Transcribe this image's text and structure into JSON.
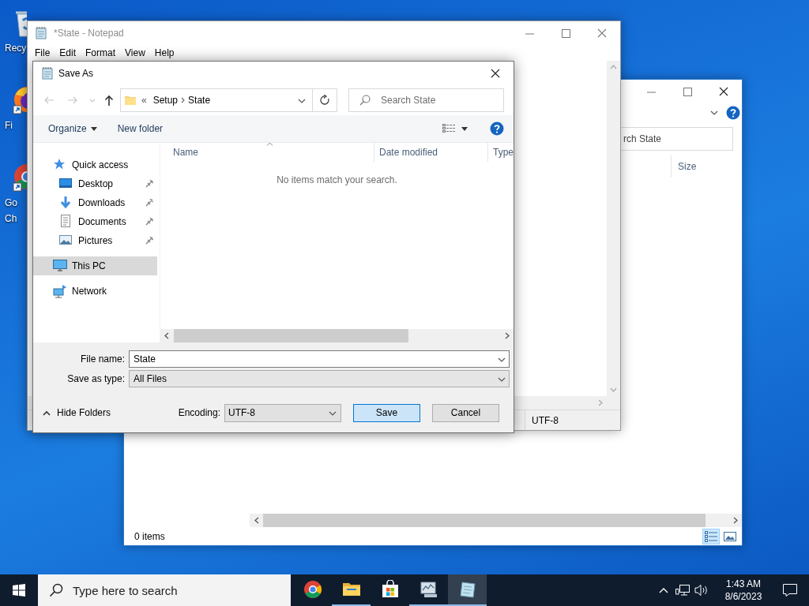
{
  "desktop_icons": [
    {
      "kind": "bin",
      "label_lines": [
        "Recy"
      ]
    },
    {
      "kind": "firefox",
      "label_lines": [
        "Fi"
      ]
    },
    {
      "kind": "chrome",
      "label_lines": [
        "Go",
        "Ch"
      ]
    }
  ],
  "explorer": {
    "search": {
      "placeholder": "rch State"
    },
    "columns": [
      "Size"
    ],
    "status": "0 items",
    "views": [
      {
        "kind": "details",
        "selected": true
      },
      {
        "kind": "tiles",
        "selected": false
      }
    ]
  },
  "notepad": {
    "title": "*State - Notepad",
    "active": false,
    "menu": [
      "File",
      "Edit",
      "Format",
      "View",
      "Help"
    ],
    "status_segments": [
      "UTF-8"
    ]
  },
  "dialog": {
    "title": "Save As",
    "nav_buttons": [
      {
        "kind": "back",
        "disabled": true
      },
      {
        "kind": "forward",
        "disabled": true
      },
      {
        "kind": "recent",
        "disabled": true
      },
      {
        "kind": "up",
        "disabled": false
      }
    ],
    "overflow": "«",
    "breadcrumb": [
      "Setup",
      "State"
    ],
    "search": {
      "placeholder": "Search State"
    },
    "commands": [
      {
        "label": "Organize",
        "dropdown": true
      },
      {
        "label": "New folder",
        "dropdown": false
      }
    ],
    "nav_tree": [
      {
        "kind": "star",
        "label": "Quick access",
        "selected": false,
        "children": [
          {
            "kind": "desktop",
            "label": "Desktop",
            "pinned": true,
            "selected": false
          },
          {
            "kind": "download",
            "label": "Downloads",
            "pinned": true,
            "selected": false
          },
          {
            "kind": "document",
            "label": "Documents",
            "pinned": true,
            "selected": false
          },
          {
            "kind": "picture",
            "label": "Pictures",
            "pinned": true,
            "selected": false
          }
        ]
      },
      {
        "kind": "computer",
        "label": "This PC",
        "selected": true
      },
      {
        "kind": "network",
        "label": "Network",
        "selected": false
      }
    ],
    "columns": [
      {
        "label": "Name",
        "sorted": true
      },
      {
        "label": "Date modified",
        "sorted": false
      },
      {
        "label": "Type",
        "sorted": false
      }
    ],
    "empty_message": "No items match your search.",
    "fields": [
      {
        "kind": "editable",
        "label": "File name:",
        "value": "State"
      },
      {
        "kind": "fixed",
        "label": "Save as type:",
        "value": "All Files"
      }
    ],
    "hide_folders": "Hide Folders",
    "encoding": {
      "label": "Encoding:",
      "value": "UTF-8"
    },
    "buttons": [
      {
        "label": "Save",
        "default": true
      },
      {
        "label": "Cancel",
        "default": false
      }
    ]
  },
  "taskbar": {
    "search": {
      "placeholder": "Type here to search"
    },
    "apps": [
      {
        "kind": "chrome",
        "running": false,
        "active": false
      },
      {
        "kind": "folder",
        "running": true,
        "active": false
      },
      {
        "kind": "store",
        "running": false,
        "active": false
      },
      {
        "kind": "monitor",
        "running": true,
        "active": false
      },
      {
        "kind": "notepad",
        "running": true,
        "active": true
      }
    ],
    "time": "1:43 AM",
    "date": "8/6/2023"
  }
}
